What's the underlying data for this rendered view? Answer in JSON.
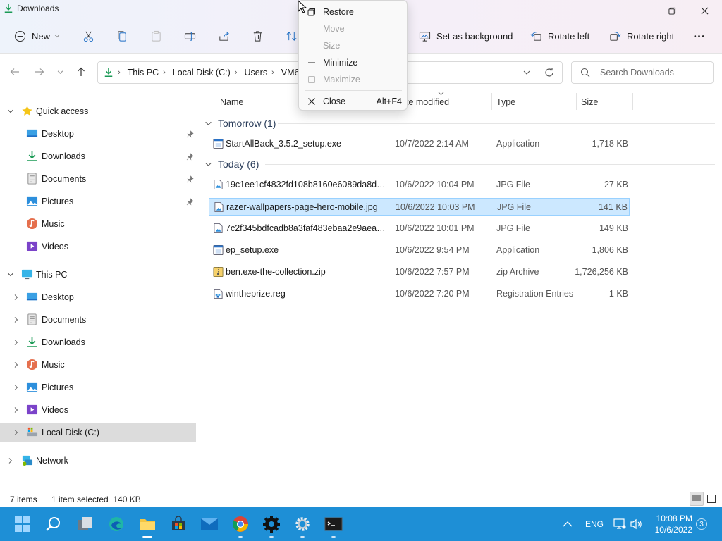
{
  "window": {
    "title": "Downloads"
  },
  "toolbar": {
    "new_label": "New",
    "set_background_label": "Set as background",
    "rotate_left_label": "Rotate left",
    "rotate_right_label": "Rotate right"
  },
  "address": {
    "crumbs": [
      "This PC",
      "Local Disk (C:)",
      "Users",
      "VM6"
    ]
  },
  "search": {
    "placeholder": "Search Downloads"
  },
  "sidebar": {
    "quick_access": {
      "label": "Quick access",
      "items": [
        {
          "label": "Desktop",
          "icon": "desktop-icon",
          "pinned": true
        },
        {
          "label": "Downloads",
          "icon": "download-icon",
          "pinned": true
        },
        {
          "label": "Documents",
          "icon": "document-icon",
          "pinned": true
        },
        {
          "label": "Pictures",
          "icon": "pictures-icon",
          "pinned": true
        },
        {
          "label": "Music",
          "icon": "music-icon",
          "pinned": false
        },
        {
          "label": "Videos",
          "icon": "videos-icon",
          "pinned": false
        }
      ]
    },
    "this_pc": {
      "label": "This PC",
      "items": [
        {
          "label": "Desktop",
          "icon": "desktop-icon"
        },
        {
          "label": "Documents",
          "icon": "document-icon"
        },
        {
          "label": "Downloads",
          "icon": "download-icon"
        },
        {
          "label": "Music",
          "icon": "music-icon"
        },
        {
          "label": "Pictures",
          "icon": "pictures-icon"
        },
        {
          "label": "Videos",
          "icon": "videos-icon"
        },
        {
          "label": "Local Disk (C:)",
          "icon": "drive-icon"
        }
      ]
    },
    "network": {
      "label": "Network"
    }
  },
  "columns": {
    "name": "Name",
    "date_modified": "Date modified",
    "type": "Type",
    "size": "Size"
  },
  "groups": [
    {
      "label": "Tomorrow (1)",
      "files": [
        {
          "name": "StartAllBack_3.5.2_setup.exe",
          "date": "10/7/2022 2:14 AM",
          "type": "Application",
          "size": "1,718 KB",
          "icon": "exe-icon"
        }
      ]
    },
    {
      "label": "Today (6)",
      "files": [
        {
          "name": "19c1ee1cf4832fd108b8160e6089da8d.jpg",
          "date": "10/6/2022 10:04 PM",
          "type": "JPG File",
          "size": "27 KB",
          "icon": "image-file-icon"
        },
        {
          "name": "razer-wallpapers-page-hero-mobile.jpg",
          "date": "10/6/2022 10:03 PM",
          "type": "JPG File",
          "size": "141 KB",
          "icon": "image-file-icon"
        },
        {
          "name": "7c2f345bdfcadb8a3faf483ebaa2e9aea712...",
          "date": "10/6/2022 10:01 PM",
          "type": "JPG File",
          "size": "149 KB",
          "icon": "image-file-icon"
        },
        {
          "name": "ep_setup.exe",
          "date": "10/6/2022 9:54 PM",
          "type": "Application",
          "size": "1,806 KB",
          "icon": "exe-icon"
        },
        {
          "name": "ben.exe-the-collection.zip",
          "date": "10/6/2022 7:57 PM",
          "type": "zip Archive",
          "size": "1,726,256 KB",
          "icon": "zip-icon"
        },
        {
          "name": "wintheprize.reg",
          "date": "10/6/2022 7:20 PM",
          "type": "Registration Entries",
          "size": "1 KB",
          "icon": "registry-icon"
        }
      ]
    }
  ],
  "status": {
    "item_count": "7 items",
    "selection": "1 item selected  140 KB"
  },
  "context_menu": {
    "items": [
      {
        "label": "Restore",
        "enabled": true,
        "accel": ""
      },
      {
        "label": "Move",
        "enabled": false,
        "accel": ""
      },
      {
        "label": "Size",
        "enabled": false,
        "accel": ""
      },
      {
        "label": "Minimize",
        "enabled": true,
        "accel": ""
      },
      {
        "label": "Maximize",
        "enabled": false,
        "accel": ""
      },
      {
        "label": "Close",
        "enabled": true,
        "accel": "Alt+F4"
      }
    ]
  },
  "taskbar": {
    "language": "ENG",
    "time": "10:08 PM",
    "date": "10/6/2022",
    "notifications": "3"
  }
}
